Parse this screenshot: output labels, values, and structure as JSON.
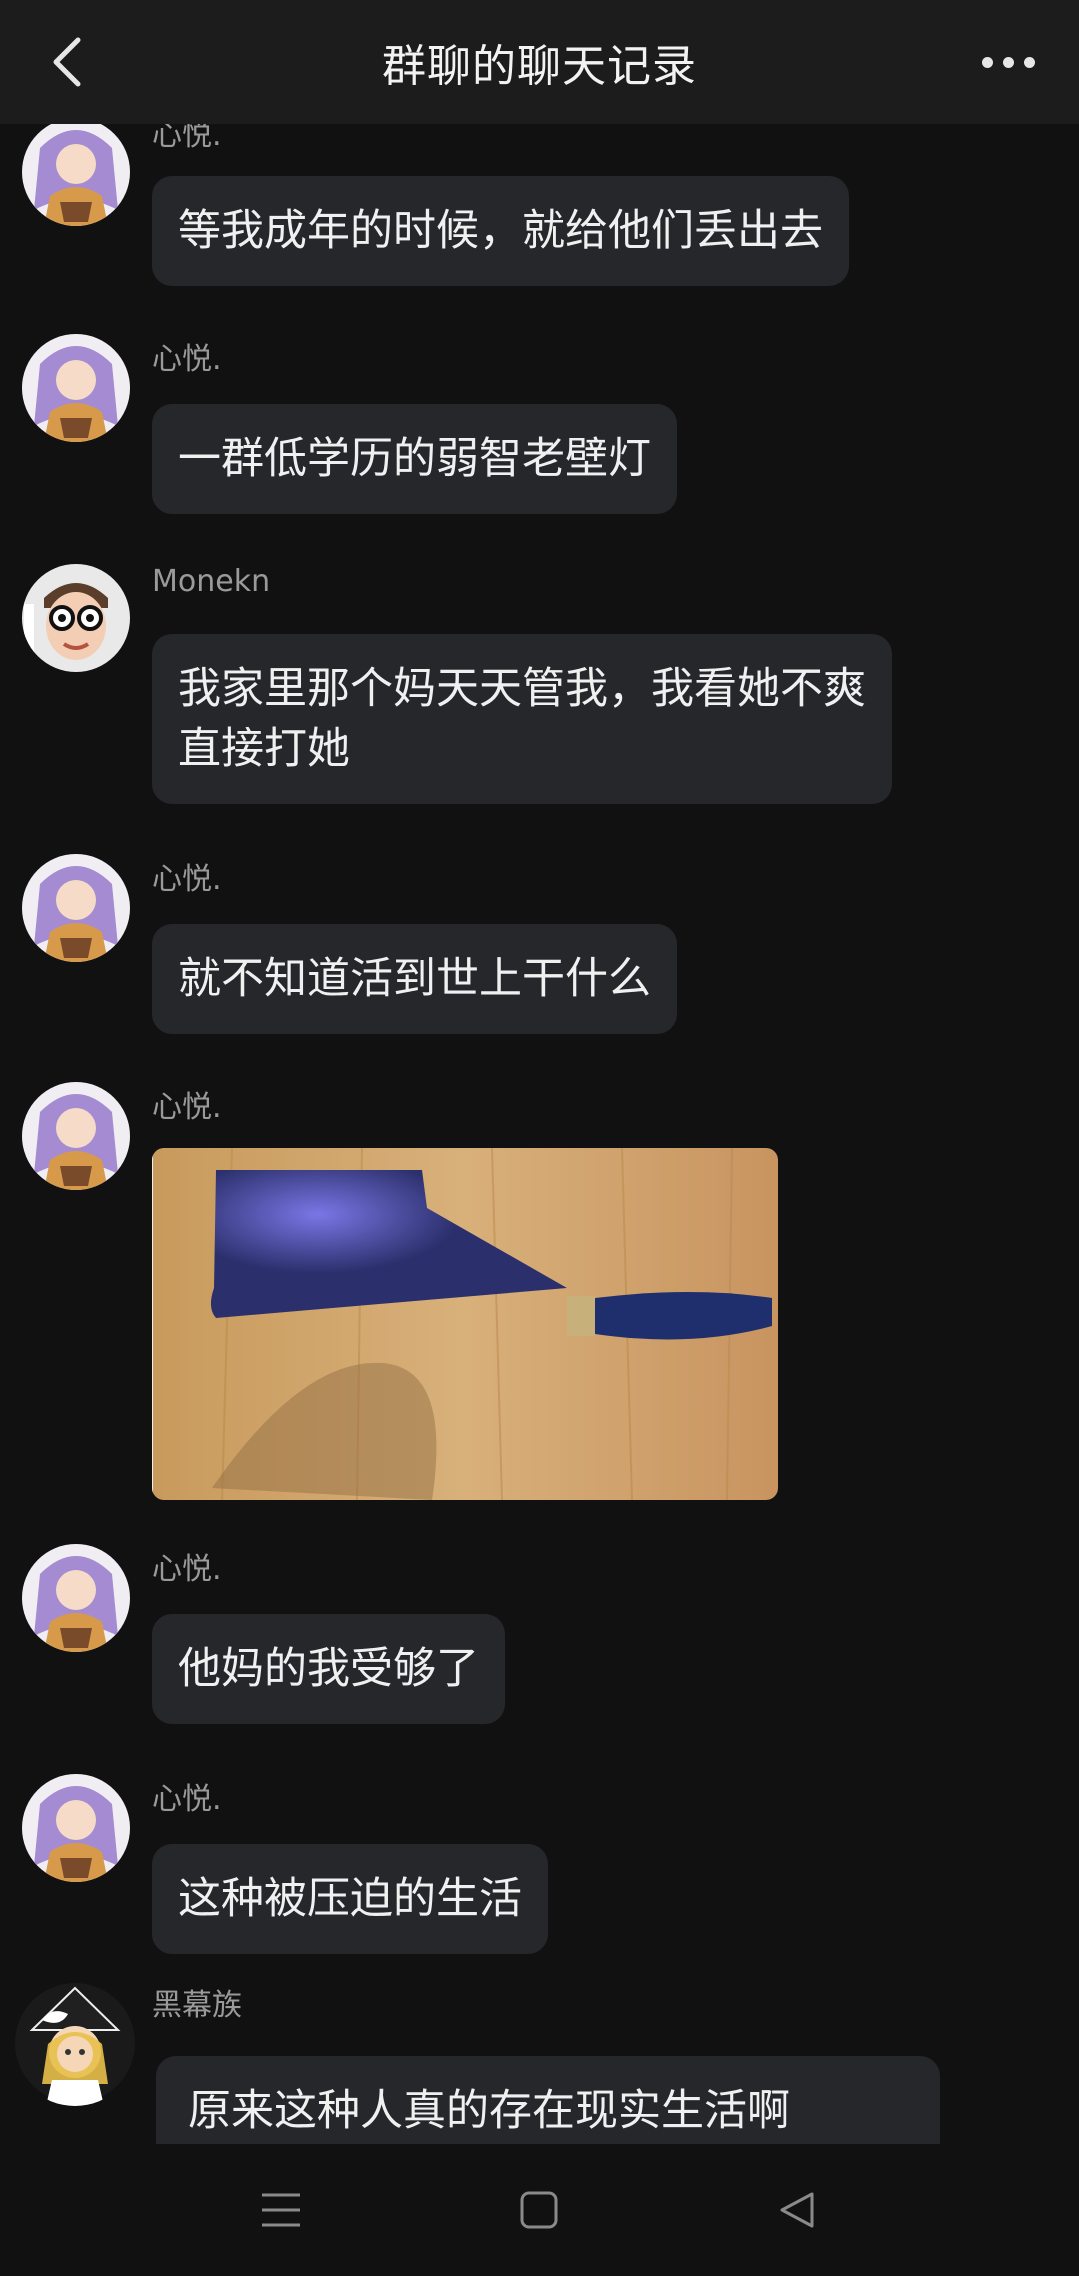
{
  "header": {
    "title": "群聊的聊天记录",
    "back_icon": "chevron-left-icon",
    "more_icon": "more-horizontal-icon"
  },
  "messages": [
    {
      "sender": "心悦.",
      "text": "等我成年的时候，就给他们丢出去",
      "type": "text",
      "avatar": "anime-girl-avatar"
    },
    {
      "sender": "心悦.",
      "text": "一群低学历的弱智老壁灯",
      "type": "text",
      "avatar": "anime-girl-avatar"
    },
    {
      "sender": "Monekn",
      "text": "我家里那个妈天天管我，我看她不爽直接打她",
      "type": "text",
      "avatar": "glasses-boy-avatar"
    },
    {
      "sender": "心悦.",
      "text": "就不知道活到世上干什么",
      "type": "text",
      "avatar": "anime-girl-avatar"
    },
    {
      "sender": "心悦.",
      "text": "",
      "type": "image",
      "image_desc": "cleaver-photo",
      "avatar": "anime-girl-avatar"
    },
    {
      "sender": "心悦.",
      "text": "他妈的我受够了",
      "type": "text",
      "avatar": "anime-girl-avatar"
    },
    {
      "sender": "心悦.",
      "text": "这种被压迫的生活",
      "type": "text",
      "avatar": "anime-girl-avatar"
    },
    {
      "sender": "黑幕族",
      "text": "原来这种人真的存在现实生活啊",
      "type": "text",
      "avatar": "witch-girl-avatar"
    }
  ],
  "navbar": {
    "menu_icon": "menu-icon",
    "home_icon": "square-home-icon",
    "back_icon": "triangle-back-icon"
  },
  "colors": {
    "background": "#111112",
    "header": "#1c1c1d",
    "bubble": "#26272b",
    "sender_name": "#9a9a9a"
  }
}
